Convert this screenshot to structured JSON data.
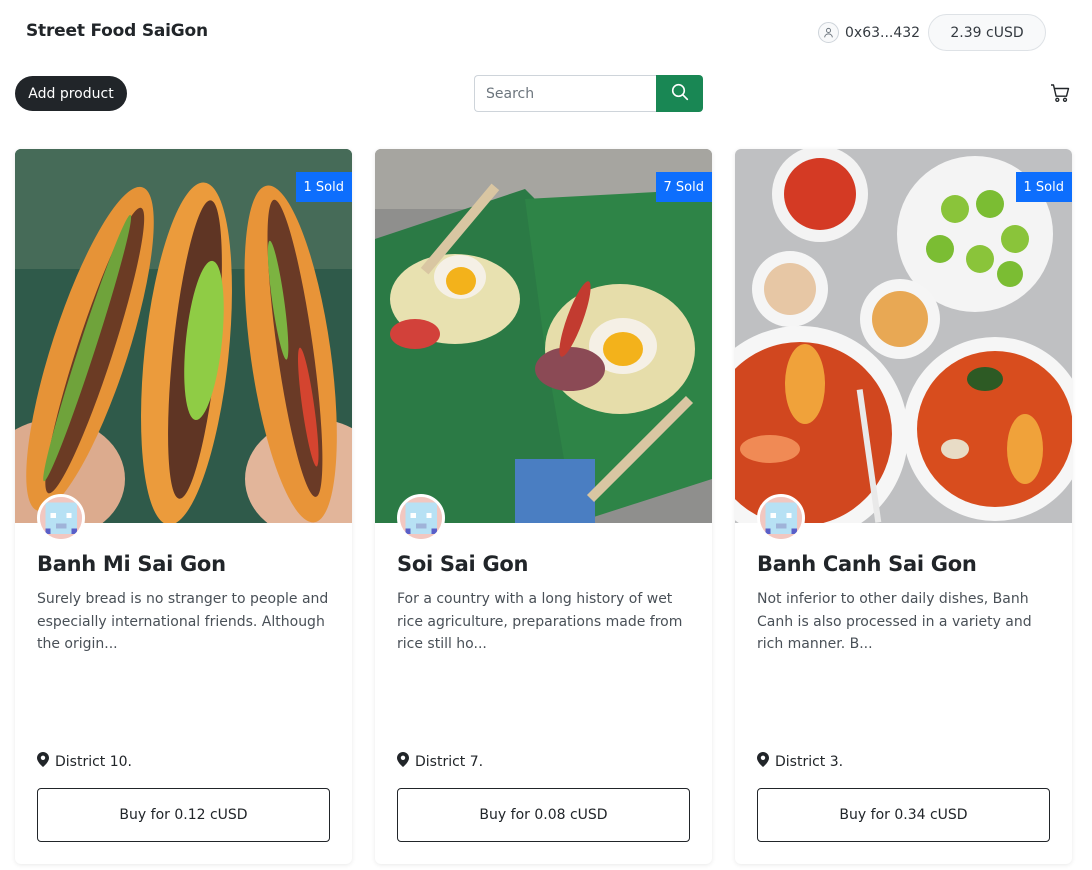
{
  "header": {
    "brand": "Street Food SaiGon",
    "account_address": "0x63...432",
    "balance": "2.39 cUSD",
    "add_product_label": "Add product",
    "search_placeholder": "Search",
    "icons": [
      "user-icon",
      "search-icon",
      "cart-icon"
    ]
  },
  "colors": {
    "primary_dark": "#212529",
    "search_green": "#198754",
    "badge_blue": "#0d6efd"
  },
  "products": [
    {
      "sold": "1 Sold",
      "title": "Banh Mi Sai Gon",
      "description": "Surely bread is no stranger to people and especially international friends. Although the origin...",
      "location": "District 10.",
      "buy_label": "Buy for 0.12 cUSD"
    },
    {
      "sold": "7 Sold",
      "title": "Soi Sai Gon",
      "description": "For a country with a long history of wet rice agriculture, preparations made from rice still ho...",
      "location": "District 7.",
      "buy_label": "Buy for 0.08 cUSD"
    },
    {
      "sold": "1 Sold",
      "title": "Banh Canh Sai Gon",
      "description": "Not inferior to other daily dishes, Banh Canh is also processed in a variety and rich manner. B...",
      "location": "District 3.",
      "buy_label": "Buy for 0.34 cUSD"
    }
  ]
}
